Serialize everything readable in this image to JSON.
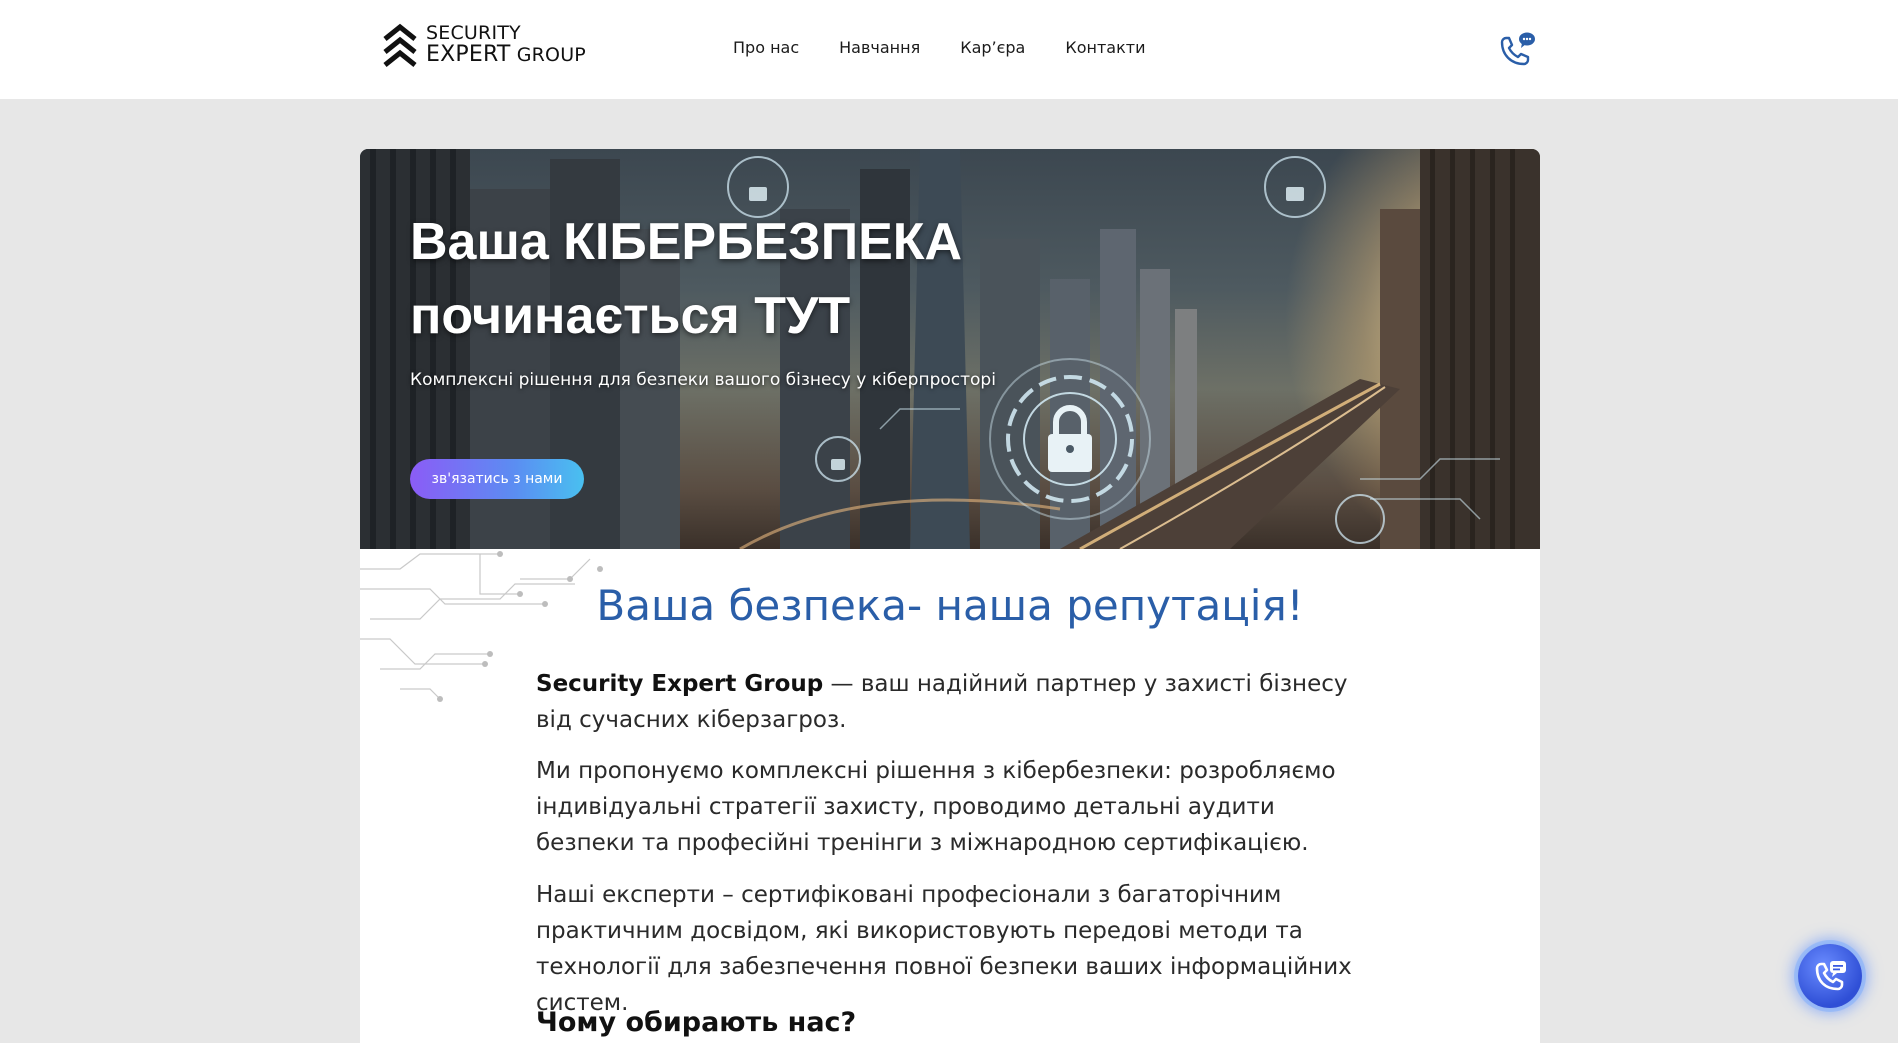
{
  "header": {
    "logo": {
      "line1": "SECURITY",
      "line2": "EXPERT",
      "line2b": " GROUP"
    },
    "nav": [
      {
        "label": "Про нас"
      },
      {
        "label": "Навчання"
      },
      {
        "label": "Кар’єра"
      },
      {
        "label": "Контакти"
      }
    ],
    "phone_icon": "phone-chat-icon"
  },
  "hero": {
    "title_line1": "Ваша КІБЕРБЕЗПЕКА",
    "title_line2": "починається ТУТ",
    "subtitle": "Комплексні рішення для безпеки вашого бізнесу у кіберпросторі",
    "button": "зв'язатись з нами"
  },
  "about": {
    "title": "Ваша безпека- наша репутація!",
    "p1_strong": "Security Expert Group",
    "p1_rest": " — ваш надійний партнер у захисті бізнесу від сучасних кіберзагроз.",
    "p2": "Ми пропонуємо комплексні рішення з кібербезпеки: розробляємо індивідуальні стратегії захисту, проводимо детальні аудити безпеки та професійні тренінги з міжнародною сертифікацією.",
    "p3": "Наші експерти – сертифіковані професіонали з багаторічним практичним досвідом, які використовують передові методи та технології для забезпечення повної безпеки ваших інформаційних систем.",
    "why_title": "Чому обирають нас?"
  },
  "floating_button": {
    "icon": "phone-chat-icon"
  },
  "colors": {
    "accent_title": "#2a5ea8",
    "button_gradient_start": "#8b5cf6",
    "button_gradient_end": "#49c0f0",
    "page_bg": "#e7e7e7"
  }
}
